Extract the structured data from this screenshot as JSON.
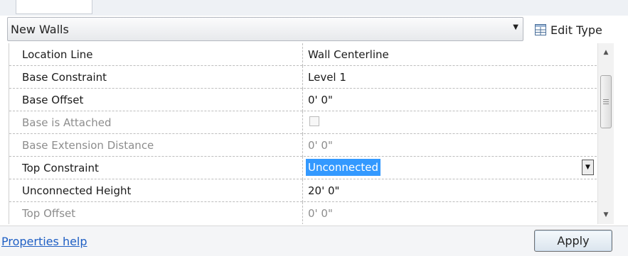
{
  "type_selector": {
    "value": "New Walls",
    "arrow_icon": "dropdown-arrow-icon"
  },
  "edit_type": {
    "label": "Edit Type",
    "icon": "edit-type-icon"
  },
  "properties": [
    {
      "name": "Location Line",
      "value": "Wall Centerline",
      "enabled": true
    },
    {
      "name": "Base Constraint",
      "value": "Level 1",
      "enabled": true
    },
    {
      "name": "Base Offset",
      "value": "0'  0\"",
      "enabled": true
    },
    {
      "name": "Base is Attached",
      "value": "",
      "enabled": false,
      "control": "checkbox",
      "checked": false
    },
    {
      "name": "Base Extension Distance",
      "value": "0'  0\"",
      "enabled": false
    },
    {
      "name": "Top Constraint",
      "value": "Unconnected",
      "enabled": true,
      "control": "select",
      "selected": true
    },
    {
      "name": "Unconnected Height",
      "value": "20'  0\"",
      "enabled": true
    },
    {
      "name": "Top Offset",
      "value": "0'  0\"",
      "enabled": false
    }
  ],
  "footer": {
    "help_link": "Properties help",
    "apply_label": "Apply"
  },
  "colors": {
    "selection": "#3399ff",
    "link": "#1f5fc4",
    "disabled_text": "#8d8d8d"
  }
}
